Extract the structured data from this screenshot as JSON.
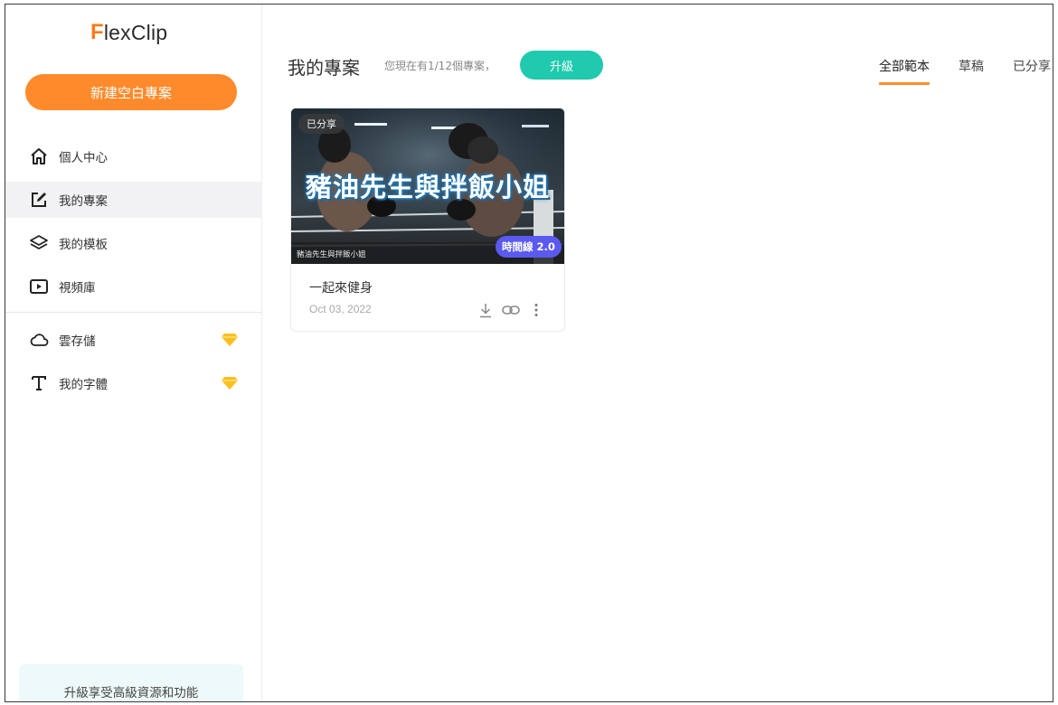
{
  "app": {
    "logo_initial": "F",
    "logo_rest": "lexClip"
  },
  "sidebar": {
    "new_project_label": "新建空白專案",
    "items": [
      {
        "label": "個人中心",
        "icon": "home-icon"
      },
      {
        "label": "我的專案",
        "icon": "edit-square-icon",
        "active": true
      },
      {
        "label": "我的模板",
        "icon": "layers-icon"
      },
      {
        "label": "視頻庫",
        "icon": "video-play-icon"
      },
      {
        "label": "雲存儲",
        "icon": "cloud-icon",
        "premium": true
      },
      {
        "label": "我的字體",
        "icon": "text-font-icon",
        "premium": true
      }
    ],
    "upgrade_card_text": "升級享受高級資源和功能"
  },
  "main": {
    "title": "我的專案",
    "quota_text": "您現在有1/12個專案，",
    "upgrade_label": "升級",
    "tabs": [
      {
        "label": "全部範本",
        "active": true
      },
      {
        "label": "草稿"
      },
      {
        "label": "已分享"
      }
    ]
  },
  "projects": [
    {
      "shared_badge": "已分享",
      "overlay_title": "豬油先生與拌飯小姐",
      "overlay_subtitle": "豬油先生與拌飯小姐",
      "timeline_badge": "時間線 2.0",
      "name": "一起來健身",
      "date": "Oct 03, 2022"
    }
  ],
  "colors": {
    "accent_orange": "#ff8a2b",
    "accent_teal": "#1fcaae",
    "badge_purple": "#5a5af0",
    "gem_yellow": "#ffbf1f"
  }
}
